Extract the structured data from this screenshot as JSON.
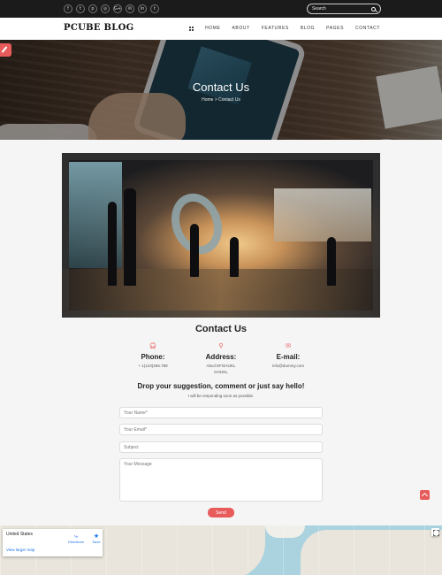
{
  "topbar": {
    "social_icons": [
      {
        "name": "facebook",
        "glyph": "f"
      },
      {
        "name": "twitter",
        "glyph": "t"
      },
      {
        "name": "pinterest",
        "glyph": "p"
      },
      {
        "name": "instagram",
        "glyph": "◎"
      },
      {
        "name": "google-plus",
        "glyph": "G+"
      },
      {
        "name": "email",
        "glyph": "✉"
      },
      {
        "name": "linkedin",
        "glyph": "in"
      },
      {
        "name": "tumblr",
        "glyph": "t"
      }
    ],
    "search_placeholder": "Search"
  },
  "nav": {
    "logo": "PCUBE BLOG",
    "items": [
      "HOME",
      "ABOUT",
      "FEATURES",
      "BLOG",
      "PAGES",
      "CONTACT"
    ]
  },
  "hero": {
    "title": "Contact Us",
    "breadcrumb": "Home  >  Contact Us"
  },
  "contact": {
    "title": "Contact Us",
    "phone": {
      "label": "Phone:",
      "value": "+ 1(123)456.789",
      "icon": "headphones-icon"
    },
    "address": {
      "label": "Address:",
      "value": "Abcd EFGHIJKL GHIJKL",
      "icon": "map-marker-icon"
    },
    "email": {
      "label": "E-mail:",
      "value": "info@dummy.com",
      "icon": "envelope-icon"
    },
    "headline": "Drop your suggestion, comment or just say hello!",
    "subline": "I will be responding soon as possible."
  },
  "form": {
    "name_placeholder": "Your Name*",
    "email_placeholder": "Your Email*",
    "subject_placeholder": "Subject",
    "message_placeholder": "Your Message",
    "send_label": "Send"
  },
  "map": {
    "place": "United States",
    "directions_label": "Directions",
    "save_label": "Save",
    "larger_map_label": "View larger map"
  },
  "colors": {
    "accent": "#e85b5b",
    "topbar": "#1b1b1b",
    "link": "#1a73e8"
  }
}
